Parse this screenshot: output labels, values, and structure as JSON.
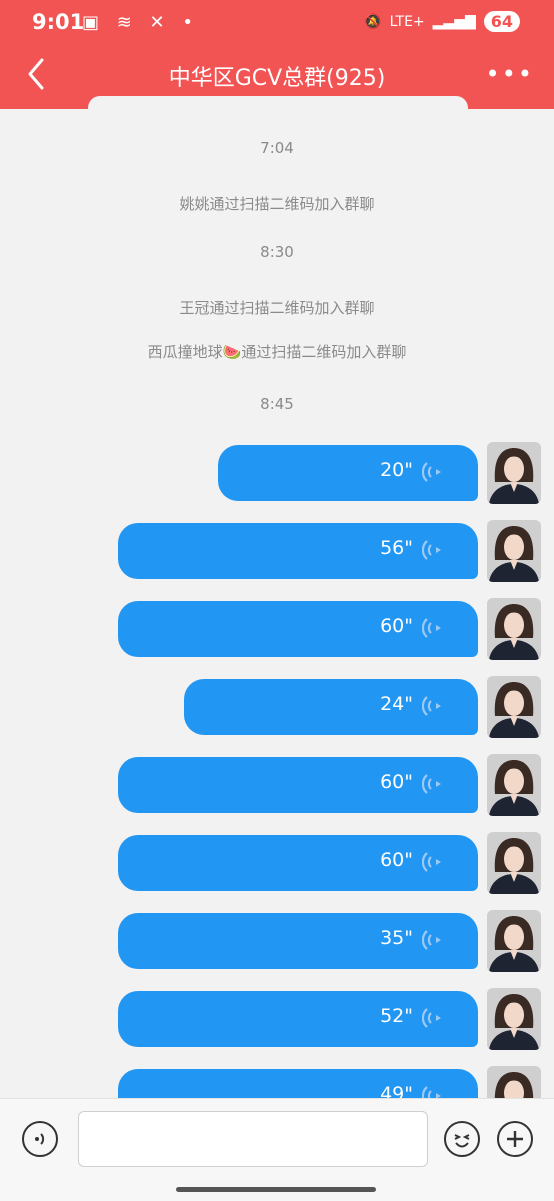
{
  "status_bar": {
    "time": "9:01",
    "network": "LTE+",
    "battery": "64"
  },
  "header": {
    "title": "中华区GCV总群(925)"
  },
  "events": [
    {
      "kind": "time",
      "text": "7:04"
    },
    {
      "kind": "system",
      "text": "姚姚通过扫描二维码加入群聊"
    },
    {
      "kind": "time",
      "text": "8:30"
    },
    {
      "kind": "system",
      "text": "王冠通过扫描二维码加入群聊"
    },
    {
      "kind": "system",
      "text": "西瓜撞地球🍉通过扫描二维码加入群聊"
    },
    {
      "kind": "time",
      "text": "8:45"
    }
  ],
  "voice_messages": [
    {
      "duration": "20\""
    },
    {
      "duration": "56\""
    },
    {
      "duration": "60\""
    },
    {
      "duration": "24\""
    },
    {
      "duration": "60\""
    },
    {
      "duration": "60\""
    },
    {
      "duration": "35\""
    },
    {
      "duration": "52\""
    },
    {
      "duration": "49\""
    }
  ],
  "composer": {
    "input_value": "",
    "icons": [
      "voice-mode-icon",
      "emoji-icon",
      "plus-icon"
    ]
  },
  "colors": {
    "header": "#f25353",
    "bubble": "#2196f3"
  }
}
